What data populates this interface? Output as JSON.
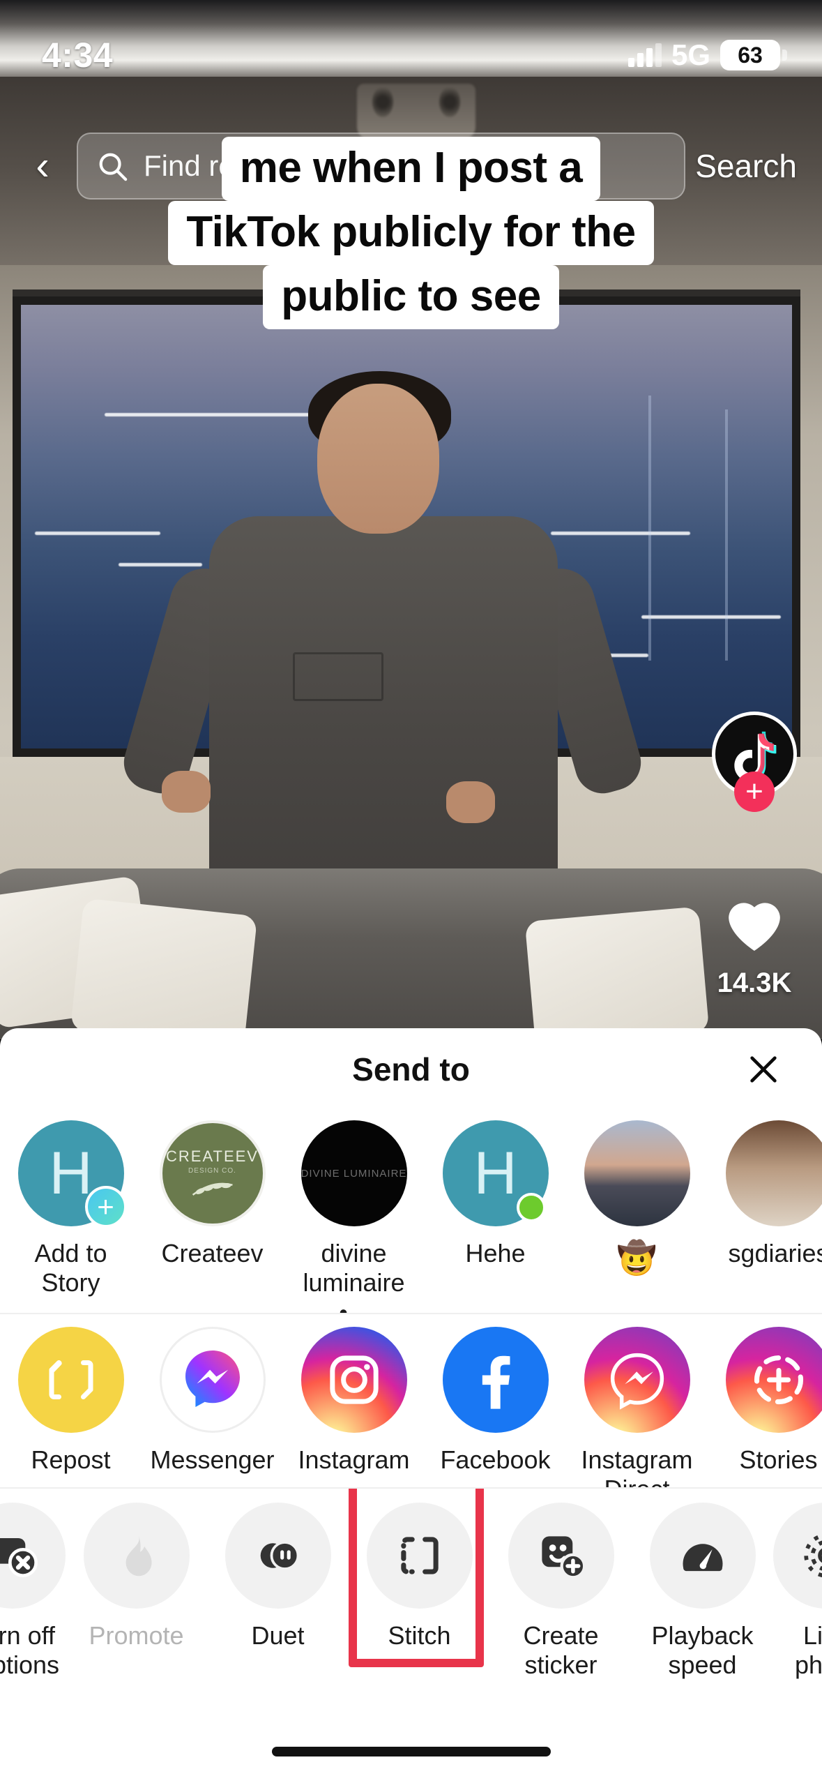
{
  "status_bar": {
    "time": "4:34",
    "network": "5G",
    "battery_level": "63",
    "signal_icon": "cellular-bars-icon",
    "battery_icon": "battery-icon"
  },
  "search": {
    "back_icon": "back-chevron-icon",
    "search_icon": "search-icon",
    "placeholder": "Find related content",
    "button_label": "Search"
  },
  "video": {
    "caption_lines": [
      "me when I post a",
      "TikTok publicly for the",
      "public to see"
    ],
    "rail": {
      "avatar_icon": "tiktok-note-avatar-icon",
      "follow_icon": "plus-follow-icon",
      "like_icon": "heart-icon",
      "like_count": "14.3K"
    }
  },
  "share_sheet": {
    "title": "Send to",
    "close_icon": "close-icon",
    "contacts": [
      {
        "label": "Add to Story",
        "avatar_type": "teal-initial",
        "initial": "H",
        "badge": "plus"
      },
      {
        "label": "Createev",
        "avatar_type": "createev-logo",
        "logo_text": "CREATEEV",
        "logo_sub": "DESIGN CO."
      },
      {
        "label": "divine luminaire •...",
        "avatar_type": "dark-logo",
        "logo_text": "DIVINE LUMINAIRE"
      },
      {
        "label": "Hehe",
        "avatar_type": "teal-initial",
        "initial": "H",
        "badge": "online"
      },
      {
        "label": "🤠",
        "avatar_type": "photo-sunset"
      },
      {
        "label": "sgdiaries",
        "avatar_type": "photo-portrait"
      }
    ],
    "apps": [
      {
        "label": "Repost",
        "icon": "repost-icon"
      },
      {
        "label": "Messenger",
        "icon": "messenger-icon"
      },
      {
        "label": "Instagram",
        "icon": "instagram-icon"
      },
      {
        "label": "Facebook",
        "icon": "facebook-icon"
      },
      {
        "label": "Instagram Direct",
        "icon": "instagram-direct-icon"
      },
      {
        "label": "Stories",
        "icon": "instagram-stories-icon"
      }
    ],
    "actions": [
      {
        "label": "Turn off captions",
        "icon": "captions-off-icon",
        "disabled": false,
        "partial": true
      },
      {
        "label": "Promote",
        "icon": "flame-icon",
        "disabled": true
      },
      {
        "label": "Duet",
        "icon": "duet-icon",
        "disabled": false
      },
      {
        "label": "Stitch",
        "icon": "stitch-icon",
        "disabled": false,
        "highlighted": true
      },
      {
        "label": "Create sticker",
        "icon": "create-sticker-icon",
        "disabled": false
      },
      {
        "label": "Playback speed",
        "icon": "speedometer-icon",
        "disabled": false
      },
      {
        "label": "Live photo",
        "icon": "live-photo-icon",
        "disabled": false,
        "partial": true
      }
    ],
    "highlight_color": "#e8344a"
  }
}
